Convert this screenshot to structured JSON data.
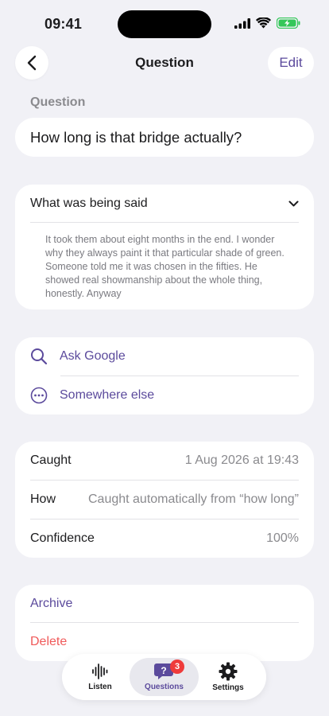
{
  "status_bar": {
    "time": "09:41"
  },
  "nav": {
    "title": "Question",
    "edit_label": "Edit"
  },
  "question": {
    "section_label": "Question",
    "text": "How long is that bridge actually?"
  },
  "context": {
    "header": "What was being said",
    "transcript": "It took them about eight months in the end. I wonder why they always paint it that particular shade of green. Someone told me it was chosen in the fifties. He showed real showmanship about the whole thing, honestly. Anyway"
  },
  "links": [
    {
      "label": "Ask Google",
      "icon": "search-icon"
    },
    {
      "label": "Somewhere else",
      "icon": "more-icon"
    }
  ],
  "info": [
    {
      "label": "Caught",
      "value": "1 Aug 2026 at 19:43"
    },
    {
      "label": "How",
      "value": "Caught automatically from “how long”"
    },
    {
      "label": "Confidence",
      "value": "100%"
    }
  ],
  "actions": {
    "archive_label": "Archive",
    "delete_label": "Delete"
  },
  "tabs": {
    "listen": {
      "label": "Listen",
      "icon": "waveform-icon"
    },
    "questions": {
      "label": "Questions",
      "icon": "question-bubble-icon",
      "badge": "3"
    },
    "settings": {
      "label": "Settings",
      "icon": "gear-icon"
    }
  },
  "colors": {
    "accent": "#5b4a9c",
    "destructive": "#f05a5a",
    "badge": "#ef3b3b",
    "background": "#f1f1f6"
  }
}
